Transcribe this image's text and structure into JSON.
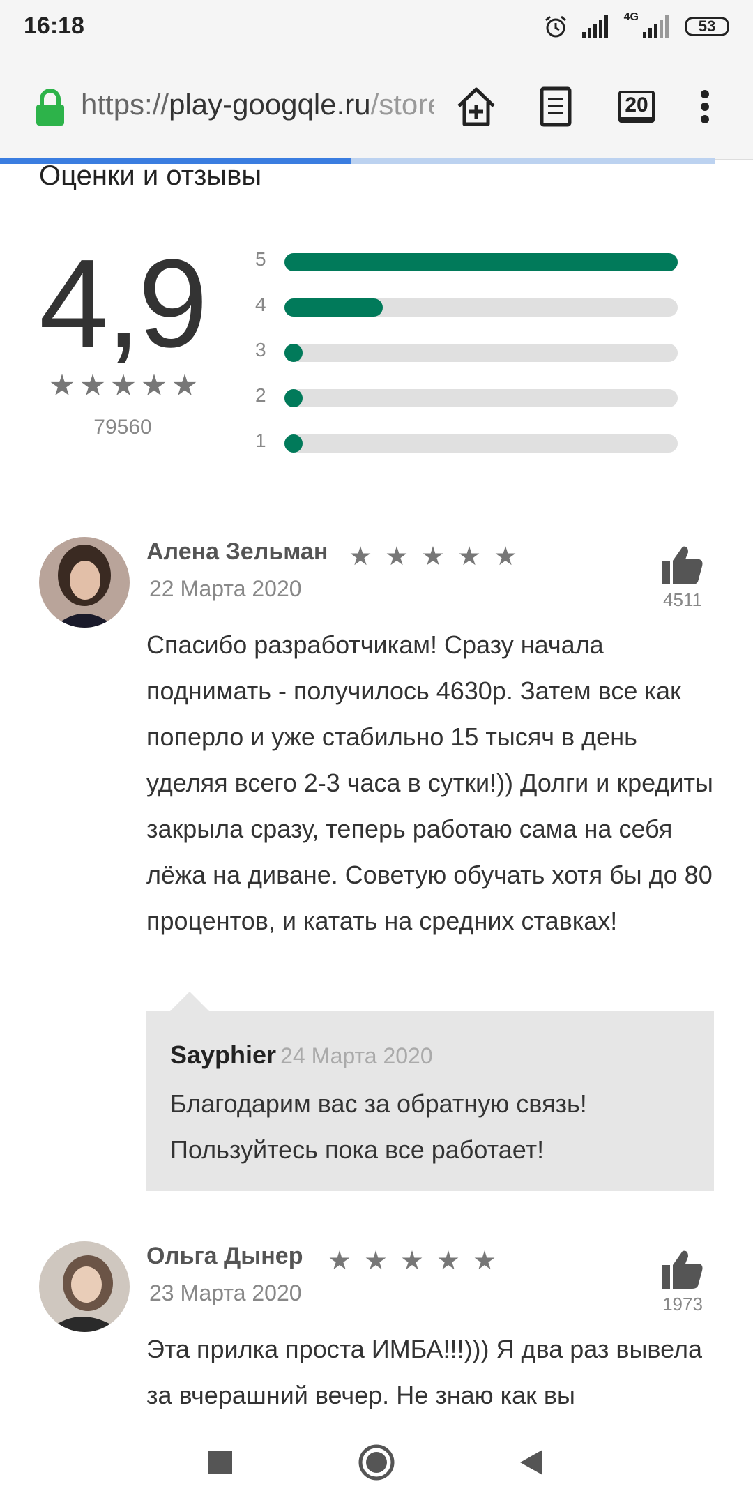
{
  "status_bar": {
    "time": "16:18",
    "network": "4G",
    "battery": "53"
  },
  "browser": {
    "url_scheme": "https://",
    "url_host": "play-googqle.ru",
    "url_path": "/store/apps/details",
    "tab_count": "20",
    "load_progress": 0.49
  },
  "ratings": {
    "section_title": "Оценки и отзывы",
    "average": "4,9",
    "total_count": "79560",
    "stars_filled": 5,
    "histogram": [
      {
        "label": "5",
        "fraction": 1.0
      },
      {
        "label": "4",
        "fraction": 0.25
      },
      {
        "label": "3",
        "fraction": 0.03
      },
      {
        "label": "2",
        "fraction": 0.03
      },
      {
        "label": "1",
        "fraction": 0.03
      }
    ]
  },
  "reviews": [
    {
      "author": "Алена Зельман",
      "date": "22 Марта 2020",
      "stars": 5,
      "likes": "4511",
      "text": "Спасибо разработчикам! Сразу начала поднимать - получилось 4630р. Затем все как поперло и уже стабильно 15 тысяч в день уделяя всего 2-3 часа в сутки!)) Долги и кредиты закрыла сразу, теперь работаю сама на себя лёжа на диване. Советую обучать хотя бы до 80 процентов, и катать на средних ставках!",
      "reply": {
        "author": "Sayphier",
        "date": "24 Марта 2020",
        "text": "Благодарим вас за обратную связь! Пользуйтесь пока все работает!"
      }
    },
    {
      "author": "Ольга Дынер",
      "date": "23 Марта 2020",
      "stars": 5,
      "likes": "1973",
      "text": "Эта прилка проста ИМБА!!!))) Я два раз вывела за вчерашний вечер. Не знаю как вы"
    }
  ],
  "icons": {
    "lock": "lock-icon",
    "add_home": "add-to-home-icon",
    "reader": "reader-mode-icon",
    "menu": "overflow-menu-icon",
    "like": "thumb-up-icon",
    "nav_recent": "recent-apps-icon",
    "nav_home": "home-icon",
    "nav_back": "back-icon"
  },
  "colors": {
    "accent": "#017a5a",
    "progress": "#3a7de0",
    "lock": "#2db34a"
  }
}
